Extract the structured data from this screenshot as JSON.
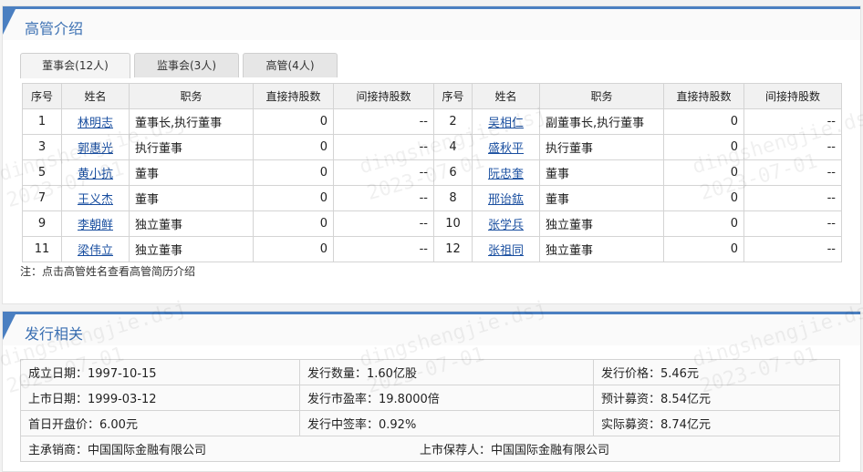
{
  "section1": {
    "title": "高管介绍",
    "tabs": [
      "董事会(12人)",
      "监事会(3人)",
      "高管(4人)"
    ],
    "columns": [
      "序号",
      "姓名",
      "职务",
      "直接持股数",
      "间接持股数",
      "序号",
      "姓名",
      "职务",
      "直接持股数",
      "间接持股数"
    ],
    "rows": [
      [
        {
          "no": "1",
          "name": "林明志",
          "post": "董事长,执行董事",
          "direct": "0",
          "indirect": "--"
        },
        {
          "no": "2",
          "name": "吴相仁",
          "post": "副董事长,执行董事",
          "direct": "0",
          "indirect": "--"
        }
      ],
      [
        {
          "no": "3",
          "name": "郭惠光",
          "post": "执行董事",
          "direct": "0",
          "indirect": "--"
        },
        {
          "no": "4",
          "name": "盛秋平",
          "post": "执行董事",
          "direct": "0",
          "indirect": "--"
        }
      ],
      [
        {
          "no": "5",
          "name": "黄小抗",
          "post": "董事",
          "direct": "0",
          "indirect": "--"
        },
        {
          "no": "6",
          "name": "阮忠奎",
          "post": "董事",
          "direct": "0",
          "indirect": "--"
        }
      ],
      [
        {
          "no": "7",
          "name": "王义杰",
          "post": "董事",
          "direct": "0",
          "indirect": "--"
        },
        {
          "no": "8",
          "name": "邢诒鈜",
          "post": "董事",
          "direct": "0",
          "indirect": "--"
        }
      ],
      [
        {
          "no": "9",
          "name": "李朝鲜",
          "post": "独立董事",
          "direct": "0",
          "indirect": "--"
        },
        {
          "no": "10",
          "name": "张学兵",
          "post": "独立董事",
          "direct": "0",
          "indirect": "--"
        }
      ],
      [
        {
          "no": "11",
          "name": "梁伟立",
          "post": "独立董事",
          "direct": "0",
          "indirect": "--"
        },
        {
          "no": "12",
          "name": "张祖同",
          "post": "独立董事",
          "direct": "0",
          "indirect": "--"
        }
      ]
    ],
    "note": "注：点击高管姓名查看高管简历介绍"
  },
  "section2": {
    "title": "发行相关",
    "rows": [
      [
        "成立日期：1997-10-15",
        "发行数量：1.60亿股",
        "发行价格：5.46元"
      ],
      [
        "上市日期：1999-03-12",
        "发行市盈率：19.8000倍",
        "预计募资：8.54亿元"
      ],
      [
        "首日开盘价：6.00元",
        "发行中签率：0.92%",
        "实际募资：8.74亿元"
      ]
    ],
    "underwriter": "主承销商：中国国际金融有限公司",
    "sponsor": "上市保荐人：中国国际金融有限公司"
  },
  "watermark": {
    "site": "dingshengjie.dsj",
    "date": "2023-07-01"
  },
  "colors": {
    "accent": "#4a7fc1",
    "title": "#3a6fb2",
    "link": "#1a4fa0"
  }
}
